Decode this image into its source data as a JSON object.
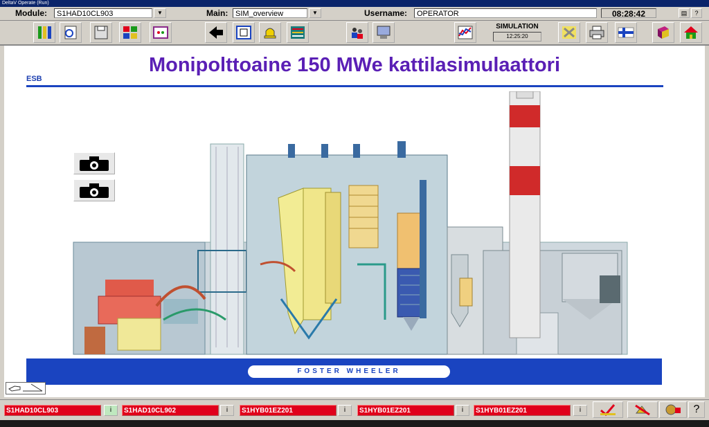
{
  "window": {
    "title": "DeltaV Operate (Run)"
  },
  "header": {
    "module_label": "Module:",
    "module_value": "S1HAD10CL903",
    "main_label": "Main:",
    "main_value": "SIM_overview",
    "username_label": "Username:",
    "username_value": "OPERATOR",
    "clock": "08:28:42",
    "help_label": "?"
  },
  "toolbar": {
    "simulation_label": "SIMULATION",
    "simulation_time": "12:25:20"
  },
  "main": {
    "heading": "Monipolttoaine 150 MWe kattilasimulaattori",
    "esb_label": "ESB",
    "brand": "FOSTER WHEELER"
  },
  "alarms": [
    {
      "tag": "S1HAD10CL903",
      "info": "i"
    },
    {
      "tag": "S1HAD10CL902",
      "info": "i"
    },
    {
      "tag": "S1HYB01EZ201",
      "info": "i"
    },
    {
      "tag": "S1HYB01EZ201",
      "info": "i"
    },
    {
      "tag": "S1HYB01EZ201",
      "info": "i"
    }
  ],
  "alarm_help": "?",
  "colors": {
    "heading": "#5a1fb5",
    "accent": "#1a44c0",
    "alarm": "#e0001b"
  }
}
